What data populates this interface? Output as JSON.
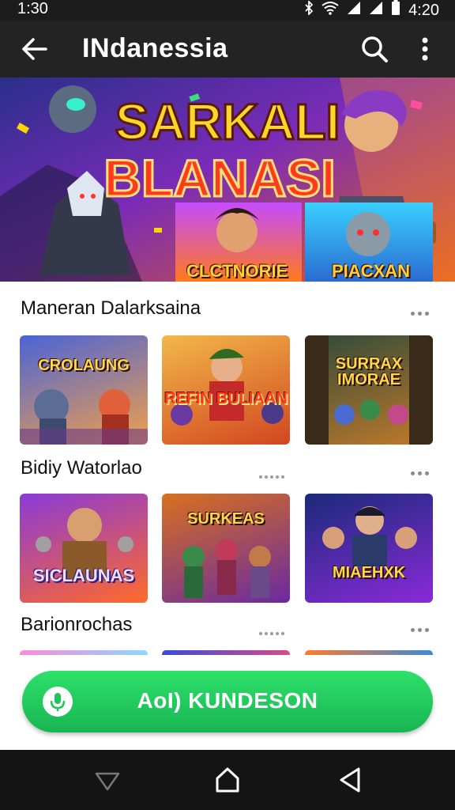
{
  "status_bar": {
    "time_left": "1:30",
    "time_right": "4:20"
  },
  "app_bar": {
    "title": "INdanessia"
  },
  "hero": {
    "title_line1": "SARKALI",
    "title_line2": "BLANASI",
    "tile_left": "CLCTNORIE",
    "tile_right": "PIACXAN"
  },
  "sections": [
    {
      "title": "Maneran Dalarksaina",
      "cards": [
        "CROLAUNG",
        "REFIN BULIAAN",
        "SURRAX IMORAE"
      ]
    },
    {
      "title": "Bidiy Watorlao",
      "cards": [
        "SICLAUNAS",
        "SURKEAS",
        "MIAEHXK"
      ]
    },
    {
      "title": "Barionrochas"
    }
  ],
  "cta": {
    "label": "AoI) KUNDESON"
  },
  "colors": {
    "accent": "#1fc55c",
    "bar": "#232323",
    "nav": "#141414"
  }
}
